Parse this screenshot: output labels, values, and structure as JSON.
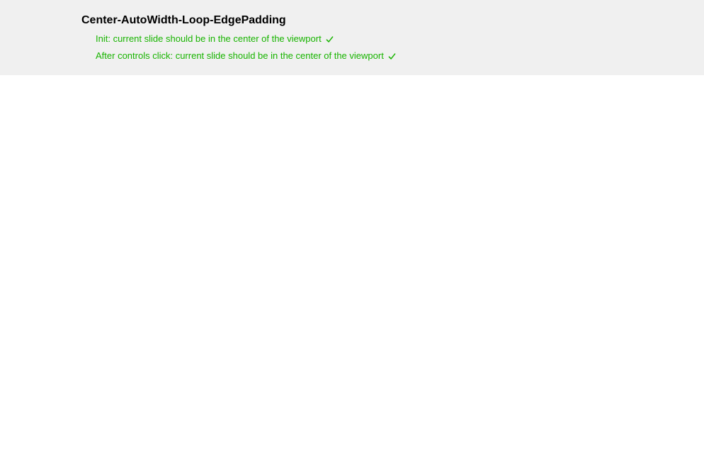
{
  "panel": {
    "title": "Center-AutoWidth-Loop-EdgePadding",
    "tests": [
      {
        "text": "Init: current slide should be in the center of the viewport",
        "status": "pass"
      },
      {
        "text": "After controls click: current slide should be in the center of the viewport",
        "status": "pass"
      }
    ]
  },
  "colors": {
    "pass": "#18b400",
    "panel_bg": "#f0f0f0"
  }
}
